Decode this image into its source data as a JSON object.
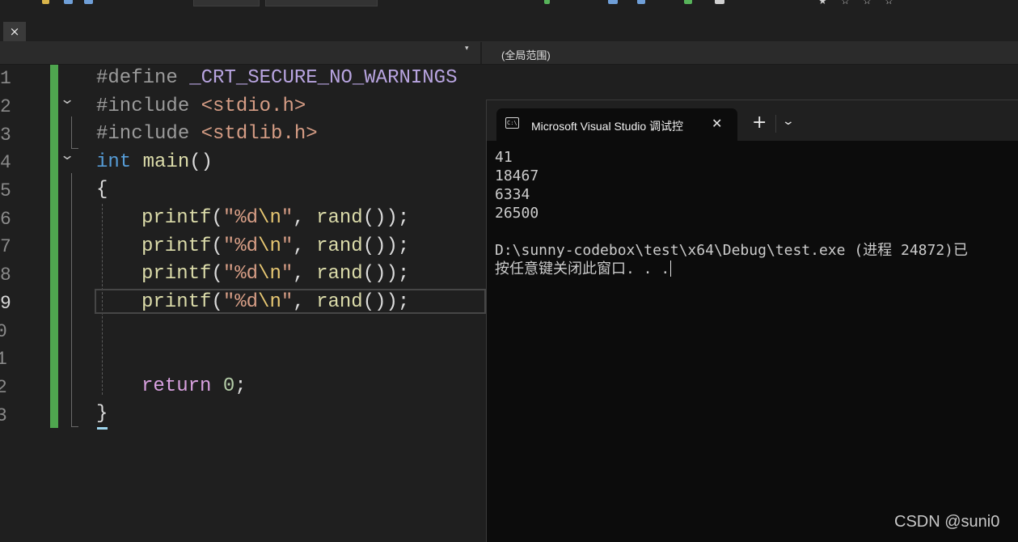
{
  "window": {
    "tab_close_glyph": "×",
    "scope_label": "(全局范围)",
    "dropdown_glyph": "▾"
  },
  "editor": {
    "line_numbers": [
      "1",
      "2",
      "3",
      "4",
      "5",
      "6",
      "7",
      "8",
      "9",
      "0",
      "1",
      "2",
      "3"
    ],
    "current_line": "9",
    "lines": {
      "l1": {
        "directive": "#define",
        "macro": "_CRT_SECURE_NO_WARNINGS"
      },
      "l2": {
        "directive": "#include",
        "header": "<stdio.h>"
      },
      "l3": {
        "directive": "#include",
        "header": "<stdlib.h>"
      },
      "l4": {
        "type": "int",
        "fn": "main",
        "rest": "()"
      },
      "l5": {
        "text": "{"
      },
      "printf_calls": [
        {
          "fn": "printf",
          "open": "(",
          "str_a": "\"%d",
          "esc": "\\n",
          "str_b": "\"",
          "sep": ", ",
          "arg": "rand",
          "close": "());"
        },
        {
          "fn": "printf",
          "open": "(",
          "str_a": "\"%d",
          "esc": "\\n",
          "str_b": "\"",
          "sep": ", ",
          "arg": "rand",
          "close": "());"
        },
        {
          "fn": "printf",
          "open": "(",
          "str_a": "\"%d",
          "esc": "\\n",
          "str_b": "\"",
          "sep": ", ",
          "arg": "rand",
          "close": "());"
        },
        {
          "fn": "printf",
          "open": "(",
          "str_a": "\"%d",
          "esc": "\\n",
          "str_b": "\"",
          "sep": ", ",
          "arg": "rand",
          "close": "());"
        }
      ],
      "l12": {
        "keyword": "return",
        "num": "0",
        "end": ";"
      },
      "l13": {
        "text": "}"
      }
    },
    "fold_glyph": "⌄"
  },
  "console": {
    "tab_title": "Microsoft Visual Studio 调试控",
    "icon_text": "C:\\",
    "close_glyph": "✕",
    "new_tab_glyph": "+",
    "dropdown_glyph": "⌄",
    "output_lines": [
      "41",
      "18467",
      "6334",
      "26500"
    ],
    "exit_line": "D:\\sunny-codebox\\test\\x64\\Debug\\test.exe (进程 24872)已",
    "prompt_line": "按任意键关闭此窗口. . ."
  },
  "watermark": "CSDN @suni0",
  "colors": {
    "editor_bg": "#1f1f1f",
    "console_bg": "#0c0c0c",
    "change_bar": "#4fa64f",
    "keyword_blue": "#569cd6",
    "function_yellow": "#dcdcaa",
    "string_orange": "#d69d85"
  }
}
